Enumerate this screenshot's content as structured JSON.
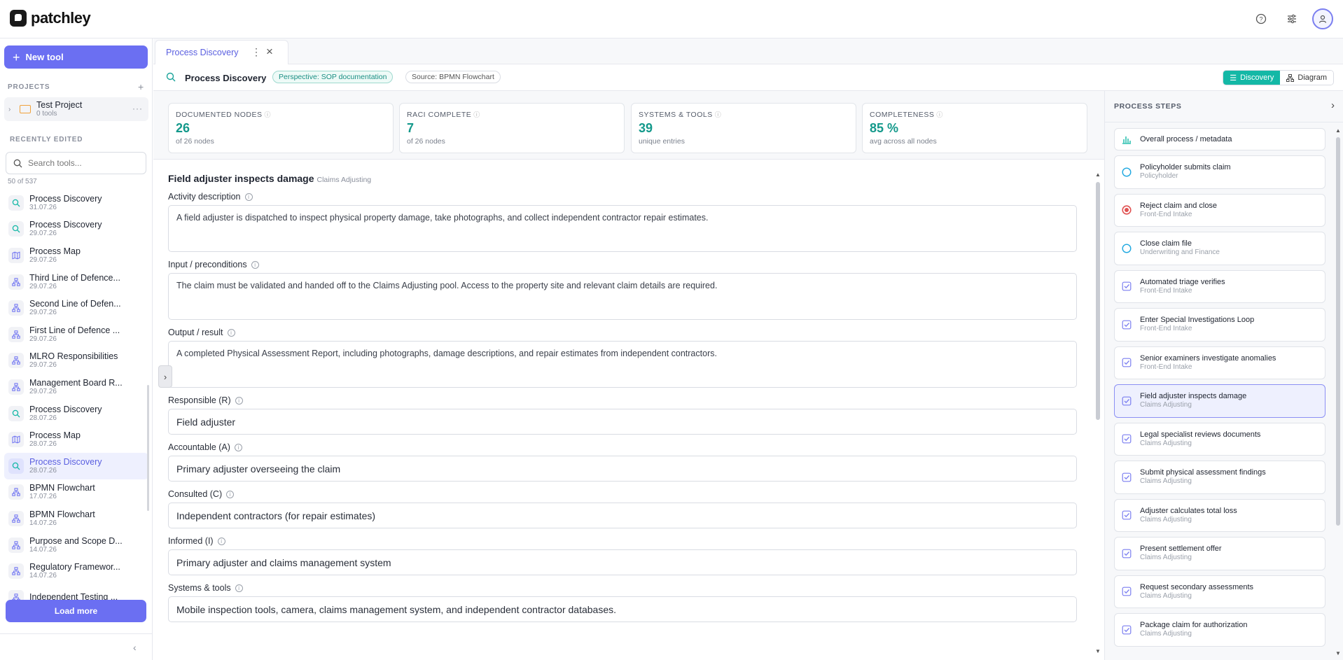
{
  "app": {
    "name": "patchley"
  },
  "top_icons": [
    "help-icon",
    "sliders-icon",
    "user-icon"
  ],
  "sidebar": {
    "new_tool_label": "New tool",
    "projects_header": "PROJECTS",
    "project": {
      "name": "Test Project",
      "sub": "0 tools"
    },
    "recent_header": "RECENTLY EDITED",
    "search_placeholder": "Search tools...",
    "count": "50 of 537",
    "tools": [
      {
        "name": "Process Discovery",
        "date": "31.07.26",
        "icon": "discovery"
      },
      {
        "name": "Process Discovery",
        "date": "29.07.26",
        "icon": "discovery"
      },
      {
        "name": "Process Map",
        "date": "29.07.26",
        "icon": "map"
      },
      {
        "name": "Third Line of Defence...",
        "date": "29.07.26",
        "icon": "flow"
      },
      {
        "name": "Second Line of Defen...",
        "date": "29.07.26",
        "icon": "flow"
      },
      {
        "name": "First Line of Defence ...",
        "date": "29.07.26",
        "icon": "flow"
      },
      {
        "name": "MLRO Responsibilities",
        "date": "29.07.26",
        "icon": "flow"
      },
      {
        "name": "Management Board R...",
        "date": "29.07.26",
        "icon": "flow"
      },
      {
        "name": "Process Discovery",
        "date": "28.07.26",
        "icon": "discovery"
      },
      {
        "name": "Process Map",
        "date": "28.07.26",
        "icon": "map"
      },
      {
        "name": "Process Discovery",
        "date": "28.07.26",
        "icon": "discovery"
      },
      {
        "name": "BPMN Flowchart",
        "date": "17.07.26",
        "icon": "flow"
      },
      {
        "name": "BPMN Flowchart",
        "date": "14.07.26",
        "icon": "flow"
      },
      {
        "name": "Purpose and Scope D...",
        "date": "14.07.26",
        "icon": "flow"
      },
      {
        "name": "Regulatory Framewor...",
        "date": "14.07.26",
        "icon": "flow"
      },
      {
        "name": "Independent Testing ...",
        "date": "",
        "icon": "flow"
      }
    ],
    "load_more_label": "Load more"
  },
  "tab": {
    "label": "Process Discovery"
  },
  "toolbar": {
    "title": "Process Discovery",
    "perspective": "Perspective: SOP documentation",
    "source": "Source: BPMN Flowchart",
    "view_discovery": "Discovery",
    "view_diagram": "Diagram"
  },
  "metrics": [
    {
      "label": "DOCUMENTED NODES",
      "value": "26",
      "sub": "of 26 nodes"
    },
    {
      "label": "RACI COMPLETE",
      "value": "7",
      "sub": "of 26 nodes"
    },
    {
      "label": "SYSTEMS & TOOLS",
      "value": "39",
      "sub": "unique entries"
    },
    {
      "label": "COMPLETENESS",
      "value": "85 %",
      "sub": "avg across all nodes"
    }
  ],
  "detail": {
    "title": "Field adjuster inspects damage",
    "lane": "Claims Adjusting",
    "activity_label": "Activity description",
    "activity_value": "A field adjuster is dispatched to inspect physical property damage, take photographs, and collect independent contractor repair estimates.",
    "input_label": "Input / preconditions",
    "input_value": "The claim must be validated and handed off to the Claims Adjusting pool. Access to the property site and relevant claim details are required.",
    "output_label": "Output / result",
    "output_value": "A completed Physical Assessment Report, including photographs, damage descriptions, and repair estimates from independent contractors.",
    "responsible_label": "Responsible (R)",
    "responsible_value": "Field adjuster",
    "accountable_label": "Accountable (A)",
    "accountable_value": "Primary adjuster overseeing the claim",
    "consulted_label": "Consulted (C)",
    "consulted_value": "Independent contractors (for repair estimates)",
    "informed_label": "Informed (I)",
    "informed_value": "Primary adjuster and claims management system",
    "systems_label": "Systems & tools",
    "systems_value": "Mobile inspection tools, camera, claims management system, and independent contractor databases."
  },
  "process_steps": {
    "title": "PROCESS STEPS",
    "meta_label": "Overall process / metadata",
    "steps": [
      {
        "name": "Policyholder submits claim",
        "lane": "Policyholder",
        "type": "start"
      },
      {
        "name": "Reject claim and close",
        "lane": "Front-End Intake",
        "type": "end"
      },
      {
        "name": "Close claim file",
        "lane": "Underwriting and Finance",
        "type": "start"
      },
      {
        "name": "Automated triage verifies",
        "lane": "Front-End Intake",
        "type": "task"
      },
      {
        "name": "Enter Special Investigations Loop",
        "lane": "Front-End Intake",
        "type": "task"
      },
      {
        "name": "Senior examiners investigate anomalies",
        "lane": "Front-End Intake",
        "type": "task"
      },
      {
        "name": "Field adjuster inspects damage",
        "lane": "Claims Adjusting",
        "type": "task",
        "selected": true
      },
      {
        "name": "Legal specialist reviews documents",
        "lane": "Claims Adjusting",
        "type": "task"
      },
      {
        "name": "Submit physical assessment findings",
        "lane": "Claims Adjusting",
        "type": "task"
      },
      {
        "name": "Adjuster calculates total loss",
        "lane": "Claims Adjusting",
        "type": "task"
      },
      {
        "name": "Present settlement offer",
        "lane": "Claims Adjusting",
        "type": "task"
      },
      {
        "name": "Request secondary assessments",
        "lane": "Claims Adjusting",
        "type": "task"
      },
      {
        "name": "Package claim for authorization",
        "lane": "Claims Adjusting",
        "type": "task"
      }
    ]
  },
  "colors": {
    "accent": "#6b6ff2",
    "teal": "#14b8a6",
    "metric_value": "#14998b"
  }
}
